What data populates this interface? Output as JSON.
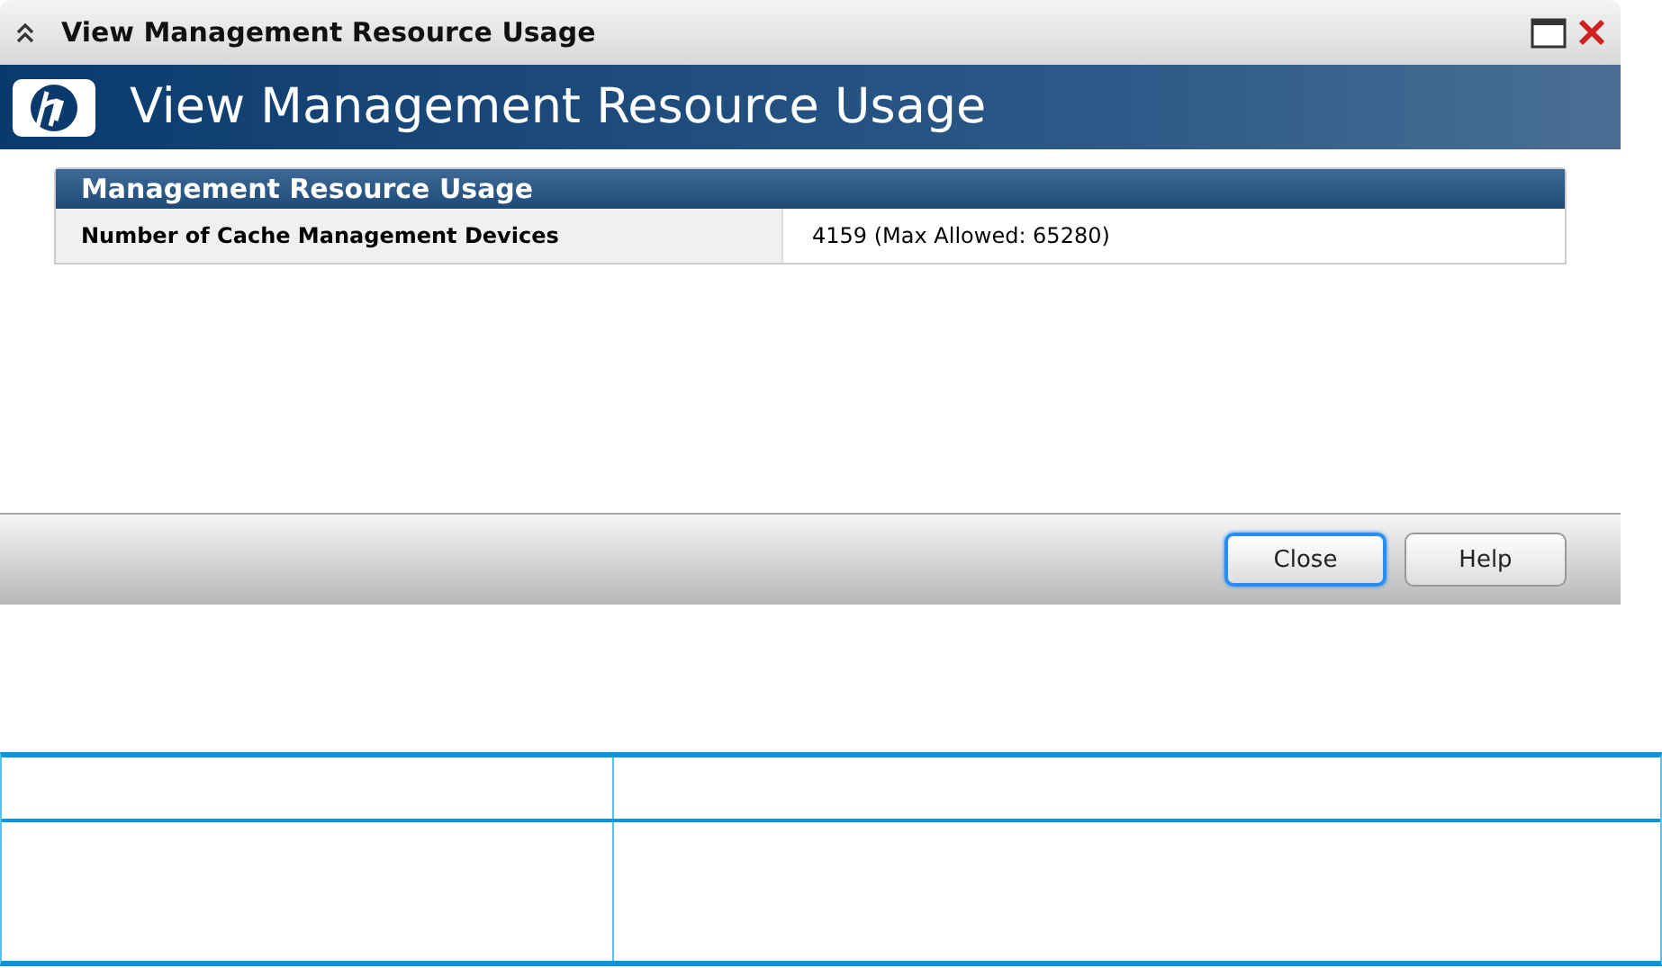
{
  "window": {
    "title": "View Management Resource Usage"
  },
  "banner": {
    "title": "View Management Resource Usage"
  },
  "panel": {
    "title": "Management Resource Usage",
    "rows": [
      {
        "label": "Number of Cache Management Devices",
        "value": "4159 (Max Allowed: 65280)"
      }
    ]
  },
  "buttons": [
    {
      "label": "Close",
      "focused": true
    },
    {
      "label": "Help",
      "focused": false
    }
  ]
}
